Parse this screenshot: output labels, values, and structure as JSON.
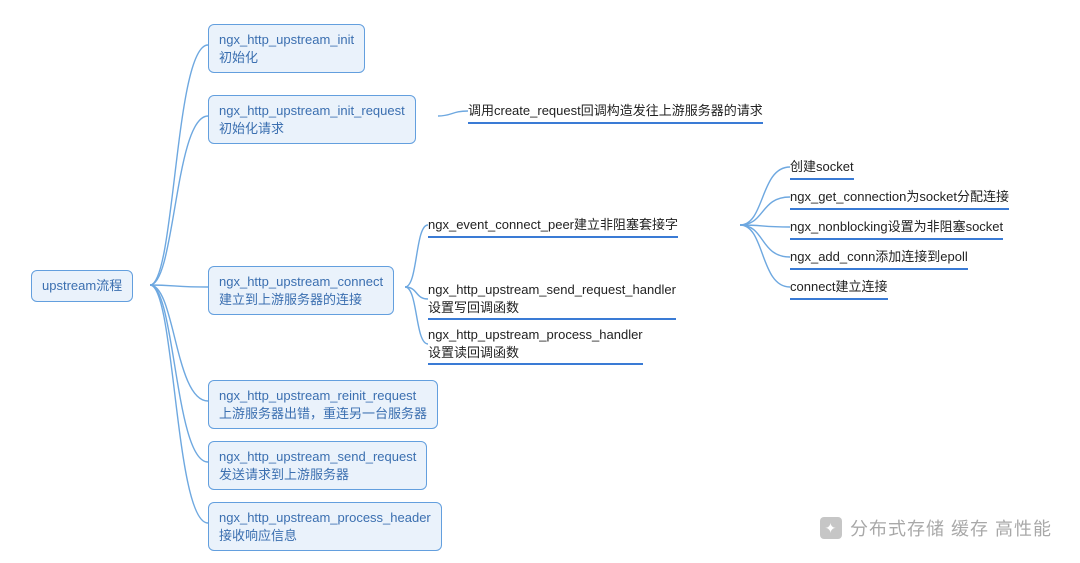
{
  "root": {
    "label": "upstream流程"
  },
  "level1": {
    "init": {
      "title": "ngx_http_upstream_init",
      "sub": "初始化"
    },
    "init_req": {
      "title": "ngx_http_upstream_init_request",
      "sub": "初始化请求"
    },
    "connect": {
      "title": "ngx_http_upstream_connect",
      "sub": "建立到上游服务器的连接"
    },
    "reinit": {
      "title": "ngx_http_upstream_reinit_request",
      "sub": "上游服务器出错，重连另一台服务器"
    },
    "send": {
      "title": "ngx_http_upstream_send_request",
      "sub": "发送请求到上游服务器"
    },
    "proc_hdr": {
      "title": "ngx_http_upstream_process_header",
      "sub": "接收响应信息"
    }
  },
  "init_req_leaf": {
    "text": "调用create_request回调构造发往上游服务器的请求"
  },
  "connect_children": {
    "peer": {
      "text": "ngx_event_connect_peer建立非阻塞套接字"
    },
    "send_hdlr": {
      "l1": "ngx_http_upstream_send_request_handler",
      "l2": "设置写回调函数"
    },
    "proc_hdlr": {
      "l1": "ngx_http_upstream_process_handler",
      "l2": "设置读回调函数"
    }
  },
  "peer_children": {
    "sock": {
      "text": "创建socket"
    },
    "getconn": {
      "text": "ngx_get_connection为socket分配连接"
    },
    "nonblk": {
      "text": "ngx_nonblocking设置为非阻塞socket"
    },
    "addconn": {
      "text": "ngx_add_conn添加连接到epoll"
    },
    "conn": {
      "text": "connect建立连接"
    }
  },
  "watermark": {
    "text": "分布式存储 缓存 高性能"
  }
}
